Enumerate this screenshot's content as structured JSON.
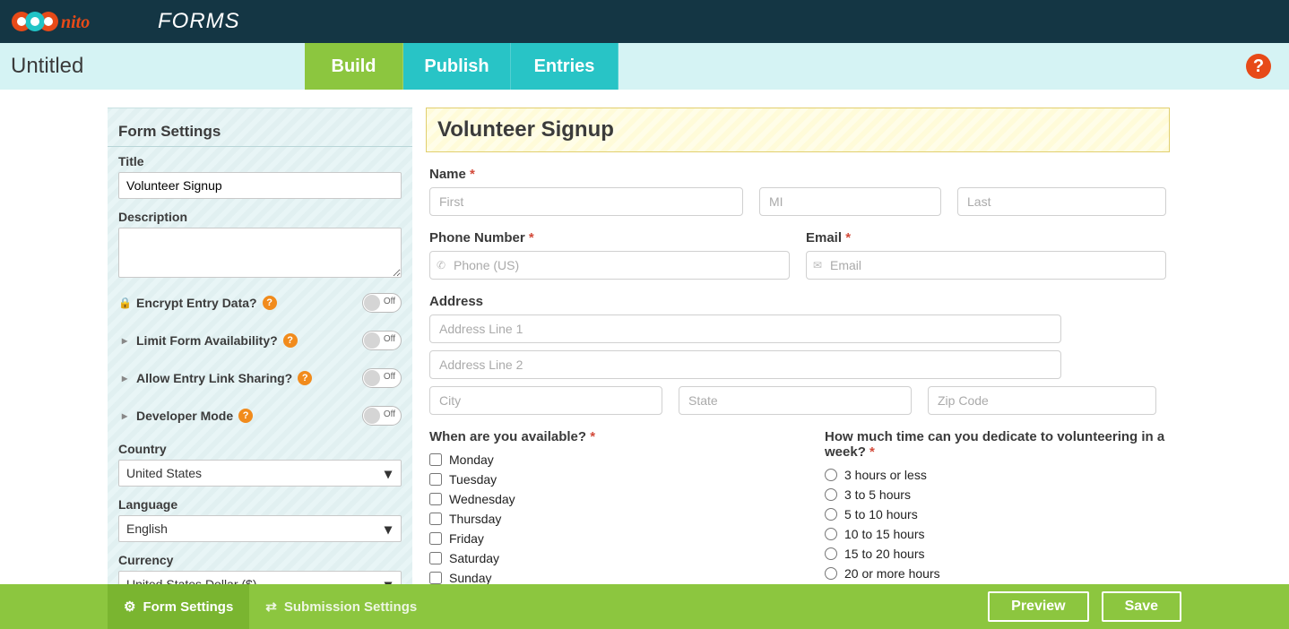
{
  "app": {
    "brand_word": "FORMS",
    "form_name": "Untitled"
  },
  "tabs": {
    "build": "Build",
    "publish": "Publish",
    "entries": "Entries"
  },
  "sidebar": {
    "section_title": "Form Settings",
    "title_label": "Title",
    "title_value": "Volunteer Signup",
    "description_label": "Description",
    "description_value": "",
    "toggles": {
      "encrypt": {
        "label": "Encrypt Entry Data?",
        "state": "Off",
        "icon": "lock"
      },
      "limit": {
        "label": "Limit Form Availability?",
        "state": "Off",
        "icon": "caret"
      },
      "linkshare": {
        "label": "Allow Entry Link Sharing?",
        "state": "Off",
        "icon": "caret"
      },
      "devmode": {
        "label": "Developer Mode",
        "state": "Off",
        "icon": "caret"
      }
    },
    "country": {
      "label": "Country",
      "value": "United States"
    },
    "language": {
      "label": "Language",
      "value": "English"
    },
    "currency": {
      "label": "Currency",
      "value": "United States Dollar ($)"
    }
  },
  "form": {
    "title": "Volunteer Signup",
    "name": {
      "label": "Name",
      "first_ph": "First",
      "mi_ph": "MI",
      "last_ph": "Last"
    },
    "phone": {
      "label": "Phone Number",
      "ph": "Phone (US)"
    },
    "email": {
      "label": "Email",
      "ph": "Email"
    },
    "address": {
      "label": "Address",
      "line1_ph": "Address Line 1",
      "line2_ph": "Address Line 2",
      "city_ph": "City",
      "state_ph": "State",
      "zip_ph": "Zip Code"
    },
    "availability": {
      "label": "When are you available?",
      "options": [
        "Monday",
        "Tuesday",
        "Wednesday",
        "Thursday",
        "Friday",
        "Saturday",
        "Sunday"
      ]
    },
    "dedicate": {
      "label": "How much time can you dedicate to volunteering in a week?",
      "options": [
        "3 hours or less",
        "3 to 5 hours",
        "5 to 10 hours",
        "10 to 15 hours",
        "15 to 20 hours",
        "20 or more hours"
      ]
    }
  },
  "bottombar": {
    "form_settings": "Form Settings",
    "submission_settings": "Submission Settings",
    "preview": "Preview",
    "save": "Save"
  }
}
